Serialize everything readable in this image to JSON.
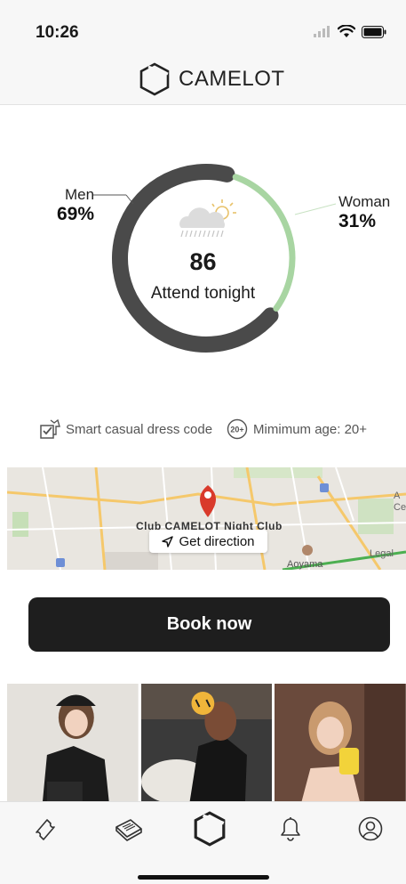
{
  "status_bar": {
    "time": "10:26"
  },
  "header": {
    "brand": "CAMELOT"
  },
  "attendance": {
    "men": {
      "label": "Men",
      "percent": "69%",
      "fraction": 0.69
    },
    "woman": {
      "label": "Woman",
      "percent": "31%",
      "fraction": 0.31
    },
    "count": "86",
    "count_label": "Attend tonight",
    "weather_icon": "rain-sun-icon"
  },
  "info": {
    "dress_code": "Smart casual dress code",
    "min_age": "Mimimum age: 20+",
    "age_badge": "20+"
  },
  "map": {
    "venue": "Club CAMELOT Night Club",
    "direction_label": "Get direction",
    "labels": {
      "aoyama": "Aoyama",
      "legal": "Legal",
      "ace_1": "A",
      "ace_2": "Ce"
    }
  },
  "cta": {
    "book_label": "Book now"
  },
  "photos": [
    {
      "name": "photo-1"
    },
    {
      "name": "photo-2"
    },
    {
      "name": "photo-3"
    }
  ],
  "tabbar": {
    "items": [
      {
        "icon": "ticket-icon"
      },
      {
        "icon": "newspaper-icon"
      },
      {
        "icon": "camelot-logo-icon"
      },
      {
        "icon": "bell-icon"
      },
      {
        "icon": "profile-icon"
      }
    ]
  },
  "colors": {
    "men_ring": "#4a4a4a",
    "woman_ring": "#a8d5a2",
    "button": "#1e1e1e",
    "background": "#ffffff"
  }
}
